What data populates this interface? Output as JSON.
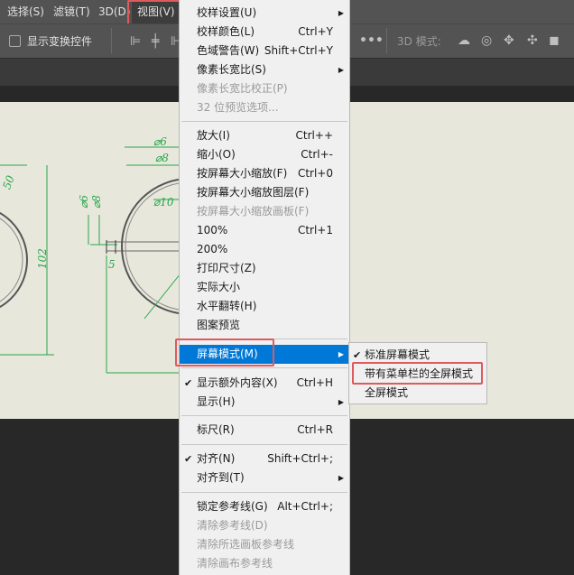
{
  "menubar": {
    "items": [
      "选择(S)",
      "滤镜(T)",
      "3D(D)",
      "视图(V)"
    ]
  },
  "options_bar": {
    "checkbox_label": "显示变换控件",
    "mode_label": "3D 模式:",
    "more": "•••"
  },
  "drawing": {
    "dims": [
      "⌀6",
      "⌀8",
      "⌀10",
      "⌀8",
      "⌀6",
      "50",
      "102",
      "5"
    ]
  },
  "view_menu": {
    "groups": [
      [
        {
          "label": "校样设置(U)",
          "shortcut": "",
          "submenu": true
        },
        {
          "label": "校样颜色(L)",
          "shortcut": "Ctrl+Y"
        },
        {
          "label": "色域警告(W)",
          "shortcut": "Shift+Ctrl+Y"
        },
        {
          "label": "像素长宽比(S)",
          "shortcut": "",
          "submenu": true
        },
        {
          "label": "像素长宽比校正(P)",
          "shortcut": "",
          "disabled": true
        },
        {
          "label": "32 位预览选项...",
          "shortcut": "",
          "disabled": true
        }
      ],
      [
        {
          "label": "放大(I)",
          "shortcut": "Ctrl++"
        },
        {
          "label": "缩小(O)",
          "shortcut": "Ctrl+-"
        },
        {
          "label": "按屏幕大小缩放(F)",
          "shortcut": "Ctrl+0"
        },
        {
          "label": "按屏幕大小缩放图层(F)",
          "shortcut": ""
        },
        {
          "label": "按屏幕大小缩放画板(F)",
          "shortcut": "",
          "disabled": true
        },
        {
          "label": "100%",
          "shortcut": "Ctrl+1"
        },
        {
          "label": "200%",
          "shortcut": ""
        },
        {
          "label": "打印尺寸(Z)",
          "shortcut": ""
        },
        {
          "label": "实际大小",
          "shortcut": ""
        },
        {
          "label": "水平翻转(H)",
          "shortcut": ""
        },
        {
          "label": "图案预览",
          "shortcut": ""
        }
      ],
      [
        {
          "label": "屏幕模式(M)",
          "shortcut": "",
          "submenu": true,
          "selected": true
        }
      ],
      [
        {
          "label": "显示额外内容(X)",
          "shortcut": "Ctrl+H",
          "checked": true
        },
        {
          "label": "显示(H)",
          "shortcut": "",
          "submenu": true
        }
      ],
      [
        {
          "label": "标尺(R)",
          "shortcut": "Ctrl+R"
        }
      ],
      [
        {
          "label": "对齐(N)",
          "shortcut": "Shift+Ctrl+;",
          "checked": true
        },
        {
          "label": "对齐到(T)",
          "shortcut": "",
          "submenu": true
        }
      ],
      [
        {
          "label": "锁定参考线(G)",
          "shortcut": "Alt+Ctrl+;"
        },
        {
          "label": "清除参考线(D)",
          "shortcut": "",
          "disabled": true
        },
        {
          "label": "清除所选画板参考线",
          "shortcut": "",
          "disabled": true
        },
        {
          "label": "清除画布参考线",
          "shortcut": "",
          "disabled": true
        }
      ]
    ]
  },
  "screen_mode_submenu": [
    {
      "label": "标准屏幕模式",
      "checked": true
    },
    {
      "label": "带有菜单栏的全屏模式",
      "checked": false
    },
    {
      "label": "全屏模式",
      "checked": false
    }
  ],
  "icons": {
    "check": "✔",
    "arrow": "▶"
  },
  "colors": {
    "selected": "#0078d7",
    "highlight": "#e0595d",
    "dimension": "#27a64a"
  }
}
